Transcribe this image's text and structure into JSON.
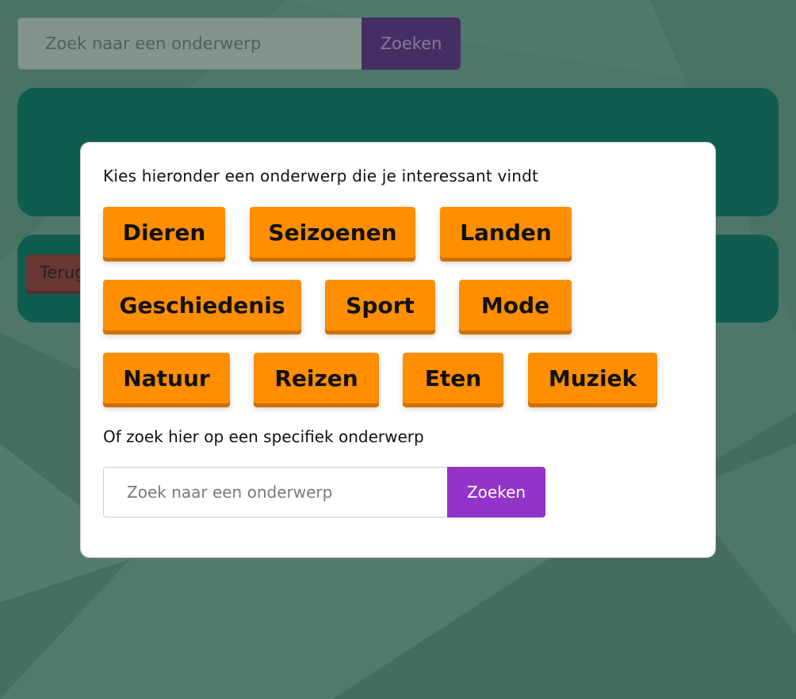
{
  "colors": {
    "background": "#55806f",
    "card": "#005e51",
    "topic_button": "#ff8e00",
    "search_button": "#9233c9",
    "back_button": "#7a2b2a"
  },
  "page": {
    "search": {
      "placeholder": "Zoek naar een onderwerp",
      "button_label": "Zoeken"
    },
    "back_button_label": "Terug"
  },
  "modal": {
    "intro": "Kies hieronder een onderwerp die je interessant vindt",
    "topics": [
      "Dieren",
      "Seizoenen",
      "Landen",
      "Geschiedenis",
      "Sport",
      "Mode",
      "Natuur",
      "Reizen",
      "Eten",
      "Muziek"
    ],
    "or_text": "Of zoek hier op een specifiek onderwerp",
    "search": {
      "placeholder": "Zoek naar een onderwerp",
      "button_label": "Zoeken"
    }
  }
}
